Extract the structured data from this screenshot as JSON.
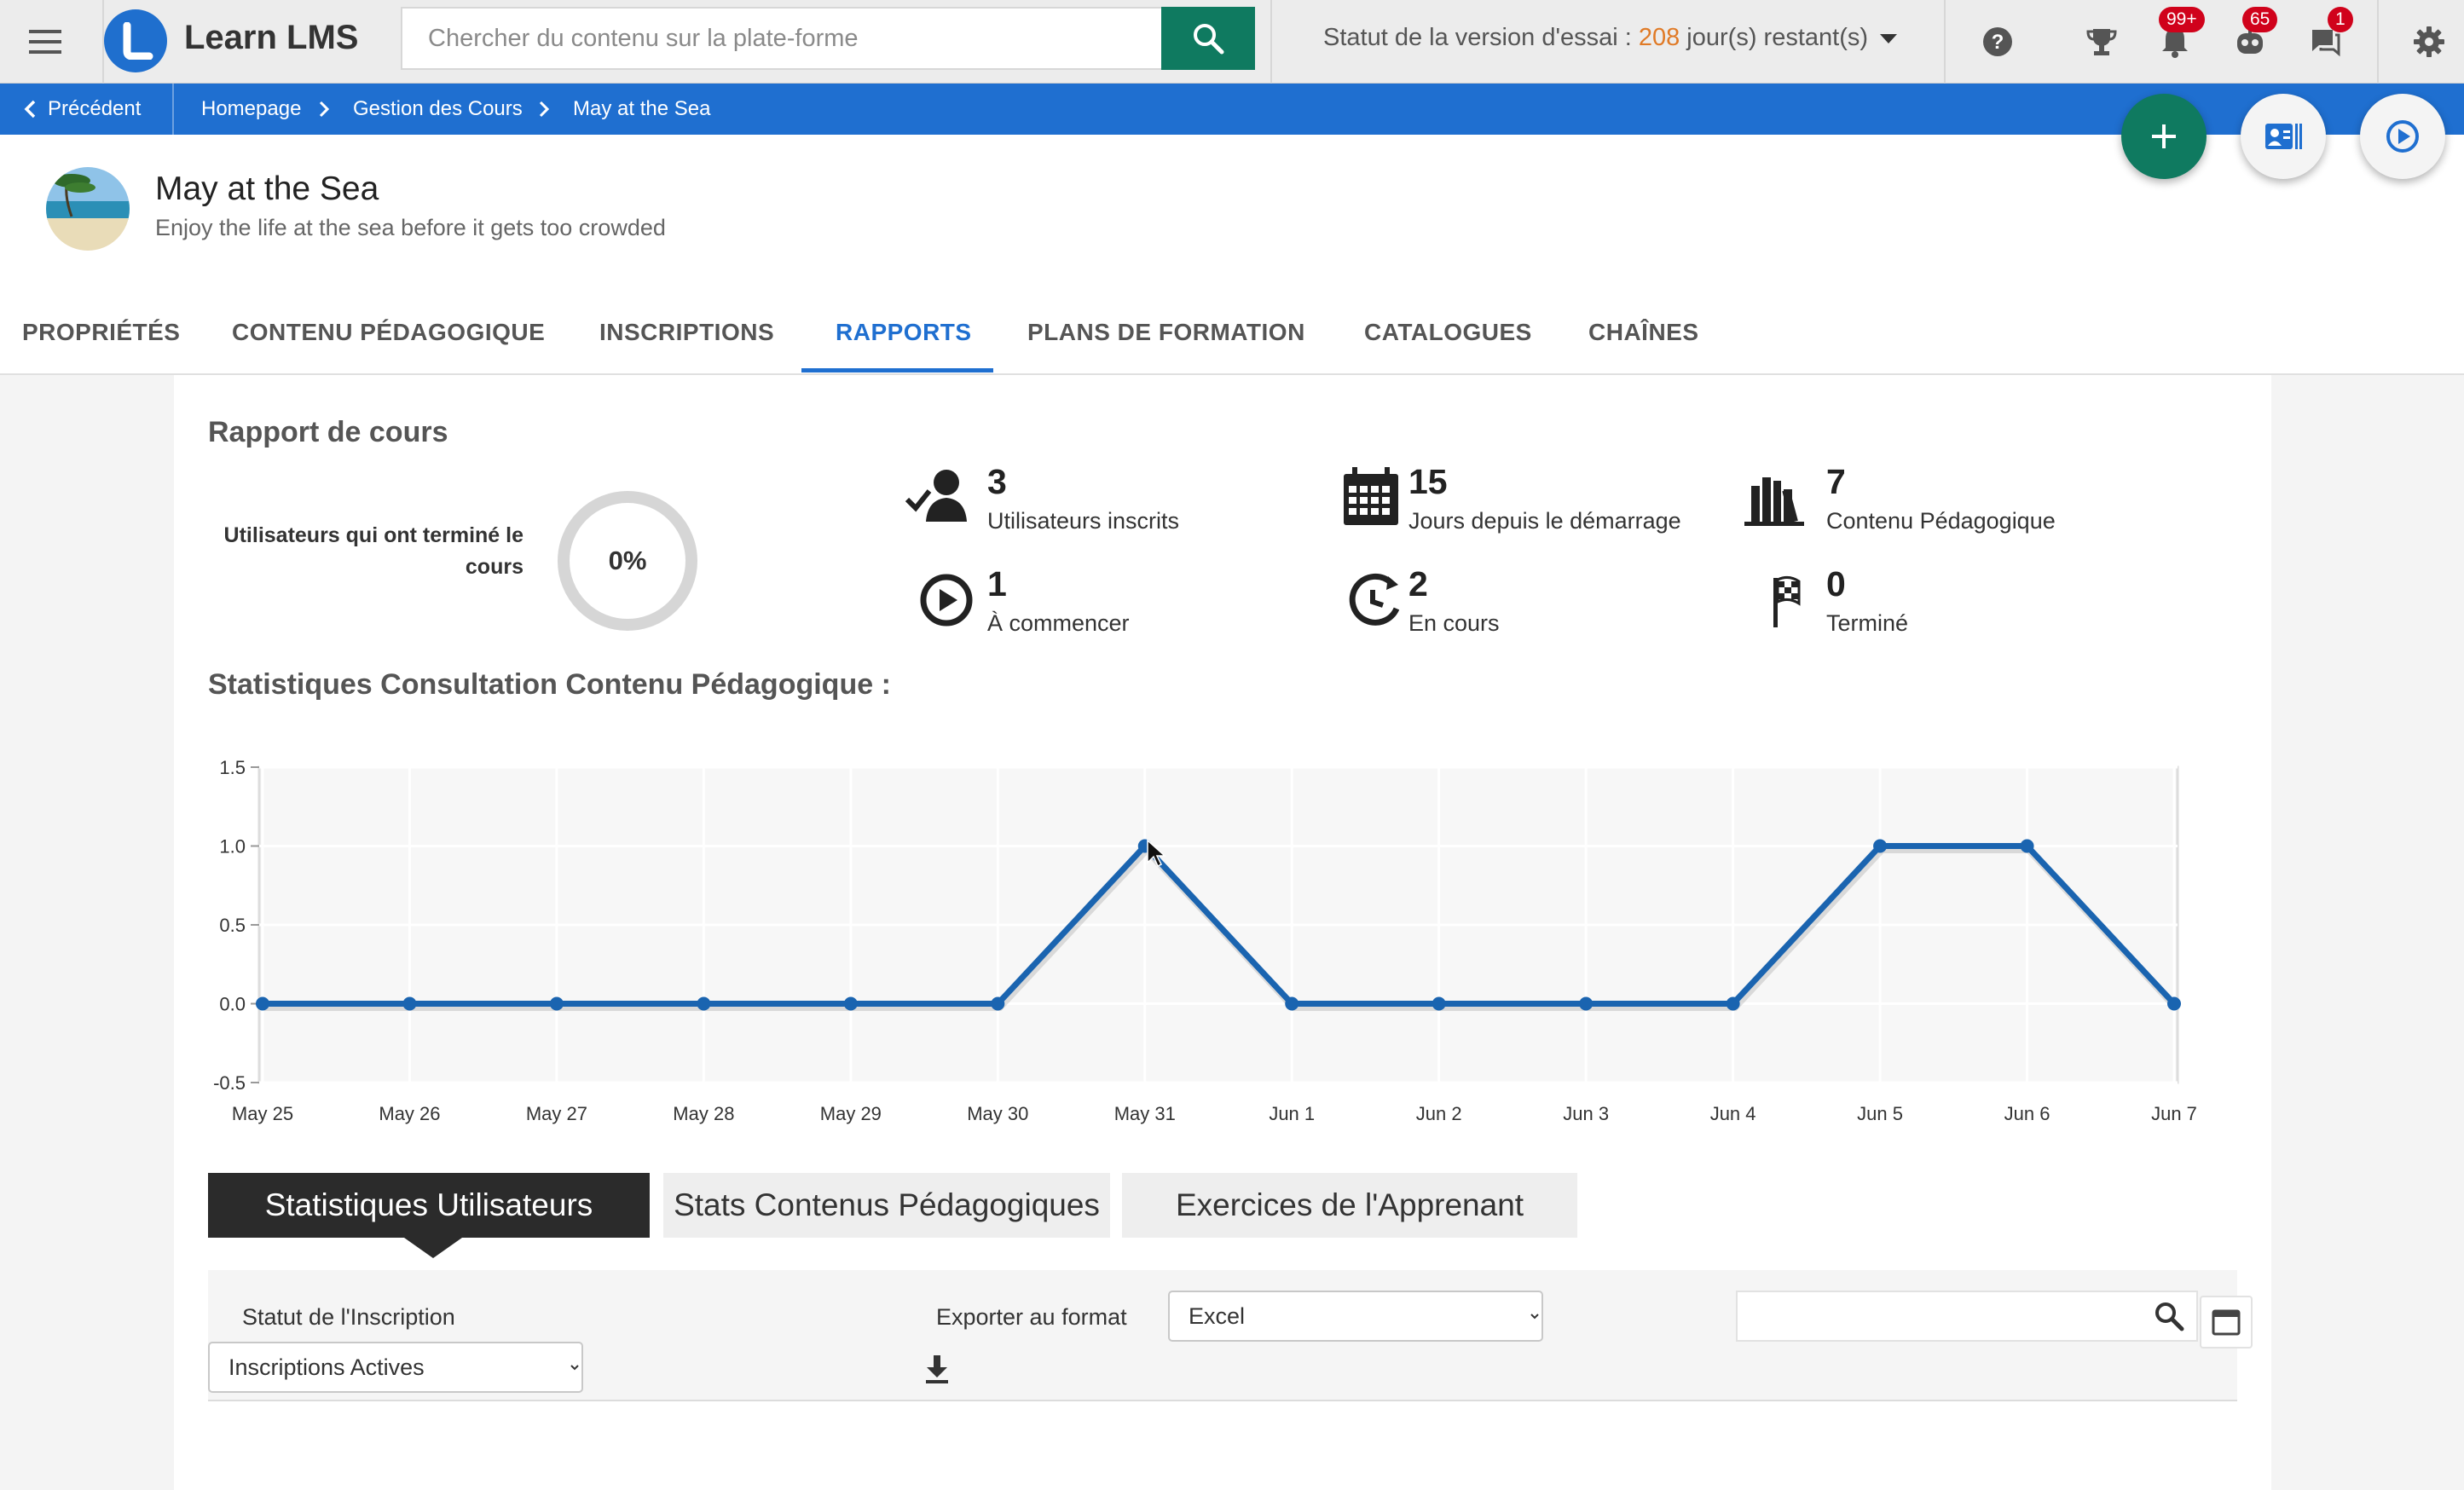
{
  "app": {
    "logo_letter": "L",
    "name": "Learn LMS"
  },
  "search": {
    "placeholder": "Chercher du contenu sur la plate-forme"
  },
  "trial": {
    "prefix": "Statut de la version d'essai : ",
    "days": "208",
    "suffix": " jour(s) restant(s)"
  },
  "topbar_icons": [
    {
      "name": "help-icon"
    },
    {
      "name": "trophy-icon"
    },
    {
      "name": "notification-bell-icon",
      "badge": "99+"
    },
    {
      "name": "bot-icon",
      "badge": "65"
    },
    {
      "name": "chat-icon",
      "badge": "1"
    },
    {
      "name": "settings-gear-icon"
    }
  ],
  "breadcrumb": {
    "back": "Précédent",
    "items": [
      "Homepage",
      "Gestion des Cours",
      "May at the Sea"
    ]
  },
  "course": {
    "title": "May at the Sea",
    "subtitle": "Enjoy the life at the sea before it gets too crowded"
  },
  "tabs": [
    "PROPRIÉTÉS",
    "CONTENU PÉDAGOGIQUE",
    "INSCRIPTIONS",
    "RAPPORTS",
    "PLANS DE FORMATION",
    "CATALOGUES",
    "CHAÎNES"
  ],
  "active_tab": "RAPPORTS",
  "report": {
    "title": "Rapport de cours",
    "completed_label": "Utilisateurs qui ont terminé le cours",
    "completed_pct": "0%",
    "stats": [
      {
        "icon": "enrolled-user-icon",
        "value": "3",
        "label": "Utilisateurs inscrits"
      },
      {
        "icon": "calendar-grid-icon",
        "value": "15",
        "label": "Jours depuis le démarrage"
      },
      {
        "icon": "books-icon",
        "value": "7",
        "label": "Contenu Pédagogique"
      },
      {
        "icon": "play-circle-icon",
        "value": "1",
        "label": "À commencer"
      },
      {
        "icon": "progress-clock-icon",
        "value": "2",
        "label": "En cours"
      },
      {
        "icon": "checkered-flag-icon",
        "value": "0",
        "label": "Terminé"
      }
    ]
  },
  "chart_title": "Statistiques Consultation Contenu Pédagogique :",
  "chart_data": {
    "type": "line",
    "categories": [
      "May 25",
      "May 26",
      "May 27",
      "May 28",
      "May 29",
      "May 30",
      "May 31",
      "Jun 1",
      "Jun 2",
      "Jun 3",
      "Jun 4",
      "Jun 5",
      "Jun 6",
      "Jun 7"
    ],
    "series": [
      {
        "values": [
          0,
          0,
          0,
          0,
          0,
          0,
          1,
          0,
          0,
          0,
          0,
          1,
          1,
          0
        ]
      }
    ],
    "ylim": [
      -0.5,
      1.5
    ],
    "yticks": [
      "1.5",
      "1.0",
      "0.5",
      "0.0",
      "-0.5"
    ],
    "grid": true,
    "color": "#1a64b0"
  },
  "subtabs": [
    "Statistiques Utilisateurs",
    "Stats Contenus Pédagogiques",
    "Exercices de l'Apprenant"
  ],
  "filters": {
    "status_label": "Statut de l'Inscription",
    "status_value": "Inscriptions Actives",
    "export_label": "Exporter au format",
    "export_value": "Excel",
    "search_placeholder": ""
  },
  "colors": {
    "brand_blue": "#1f6fd0",
    "green": "#0f7a60",
    "badge_red": "#d0021b",
    "trial_orange": "#e07a26"
  }
}
